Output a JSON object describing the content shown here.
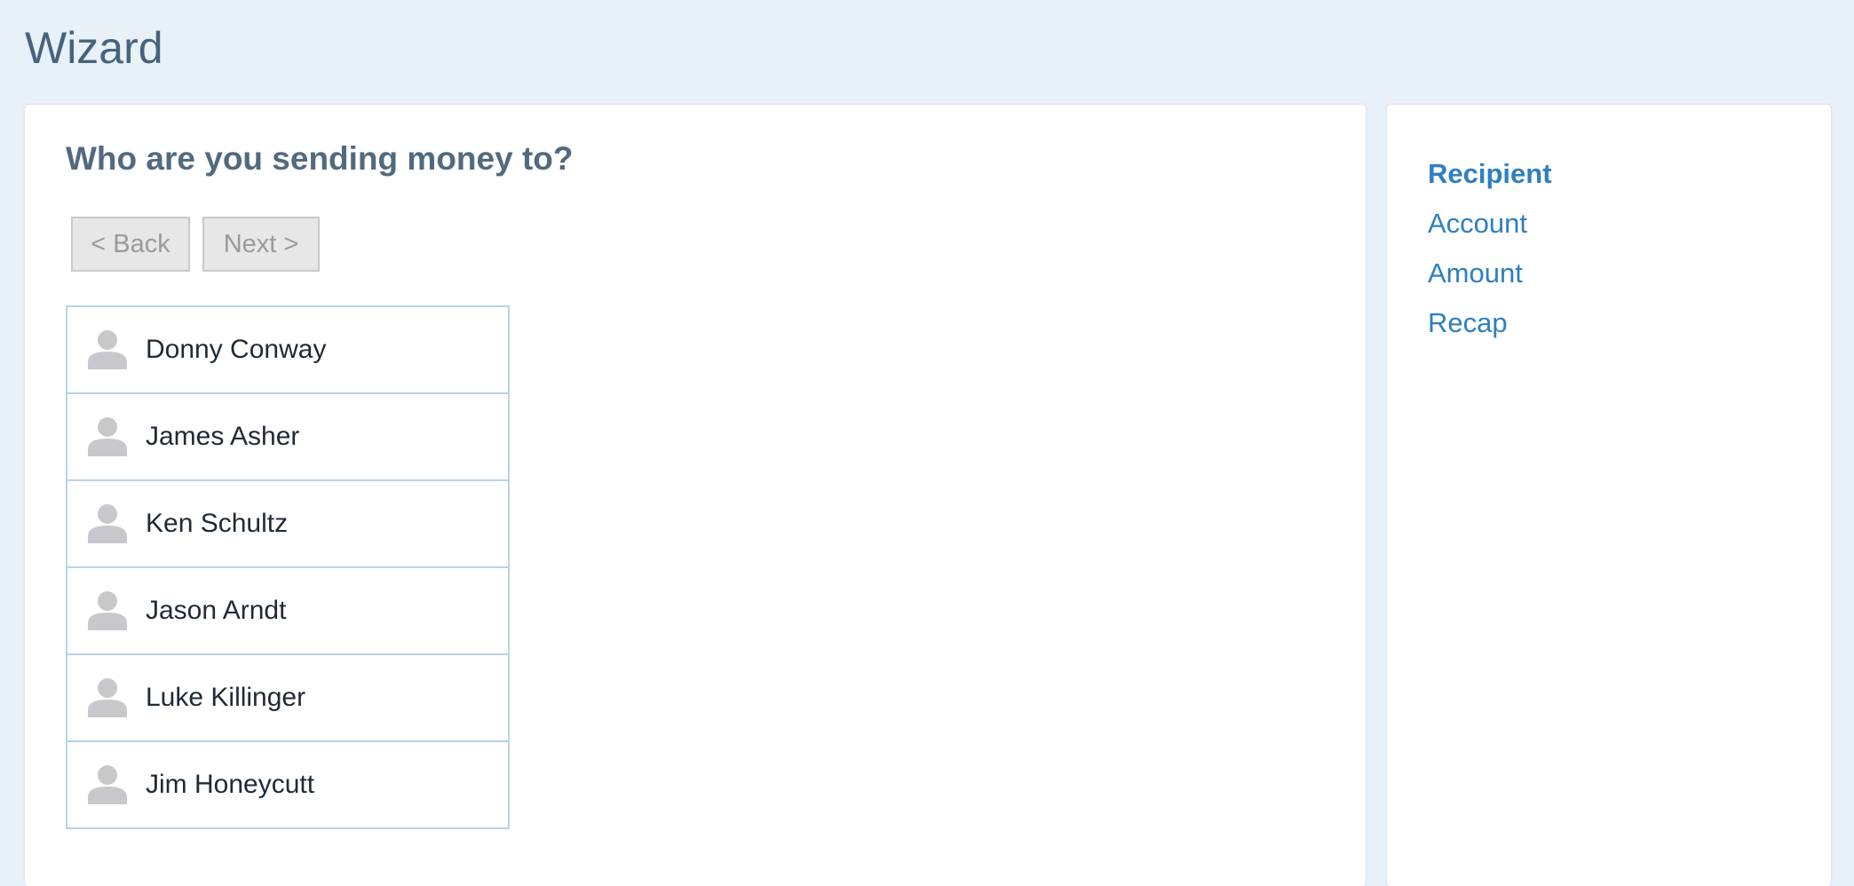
{
  "page": {
    "title": "Wizard"
  },
  "main": {
    "question": "Who are you sending money to?",
    "back_label": "< Back",
    "next_label": "Next >",
    "recipients": [
      {
        "name": "Donny Conway"
      },
      {
        "name": "James Asher"
      },
      {
        "name": "Ken Schultz"
      },
      {
        "name": "Jason Arndt"
      },
      {
        "name": "Luke Killinger"
      },
      {
        "name": "Jim Honeycutt"
      }
    ],
    "avatar_icon": "user-silhouette-icon"
  },
  "steps": [
    {
      "label": "Recipient",
      "active": true
    },
    {
      "label": "Account",
      "active": false
    },
    {
      "label": "Amount",
      "active": false
    },
    {
      "label": "Recap",
      "active": false
    }
  ],
  "colors": {
    "background": "#e8f0f8",
    "title": "#46637e",
    "link": "#2f7fc0",
    "list_border": "#b7d3e8",
    "avatar": "#c8c8cc"
  }
}
